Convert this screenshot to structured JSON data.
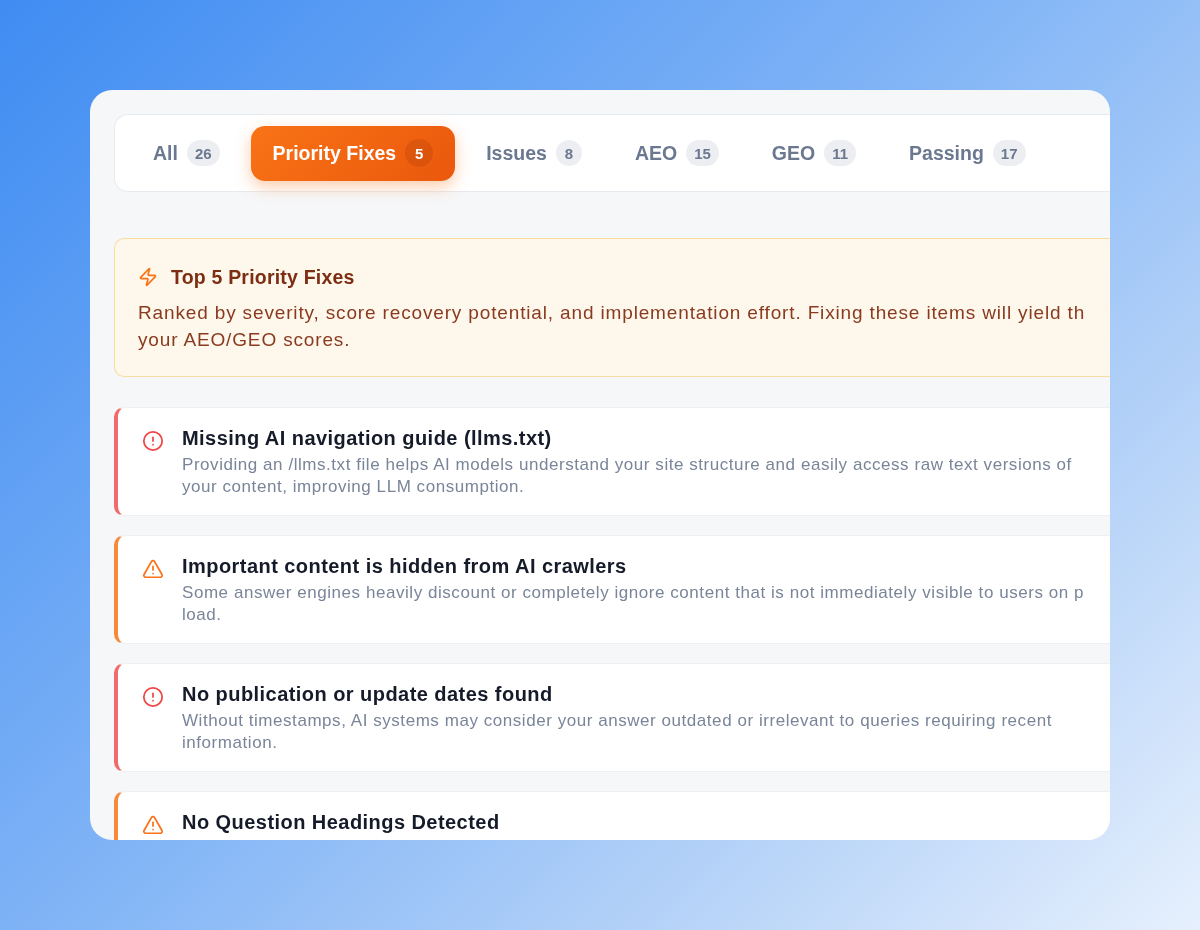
{
  "tabs": [
    {
      "label": "All",
      "count": "26",
      "selected": false
    },
    {
      "label": "Priority Fixes",
      "count": "5",
      "selected": true
    },
    {
      "label": "Issues",
      "count": "8",
      "selected": false
    },
    {
      "label": "AEO",
      "count": "15",
      "selected": false
    },
    {
      "label": "GEO",
      "count": "11",
      "selected": false
    },
    {
      "label": "Passing",
      "count": "17",
      "selected": false
    }
  ],
  "banner": {
    "title": "Top 5 Priority Fixes",
    "text": "Ranked by severity, score recovery potential, and implementation effort. Fixing these items will yield th\nyour AEO/GEO scores."
  },
  "fixes": [
    {
      "kind": "critical",
      "title": "Missing AI navigation guide (llms.txt)",
      "description": "Providing an /llms.txt file helps AI models understand your site structure and easily access raw text versions of\nyour content, improving LLM consumption."
    },
    {
      "kind": "warning",
      "title": "Important content is hidden from AI crawlers",
      "description": "Some answer engines heavily discount or completely ignore content that is not immediately visible to users on p\nload."
    },
    {
      "kind": "critical",
      "title": "No publication or update dates found",
      "description": "Without timestamps, AI systems may consider your answer outdated or irrelevant to queries requiring recent\ninformation."
    },
    {
      "kind": "warning",
      "title": "No Question Headings Detected"
    }
  ]
}
